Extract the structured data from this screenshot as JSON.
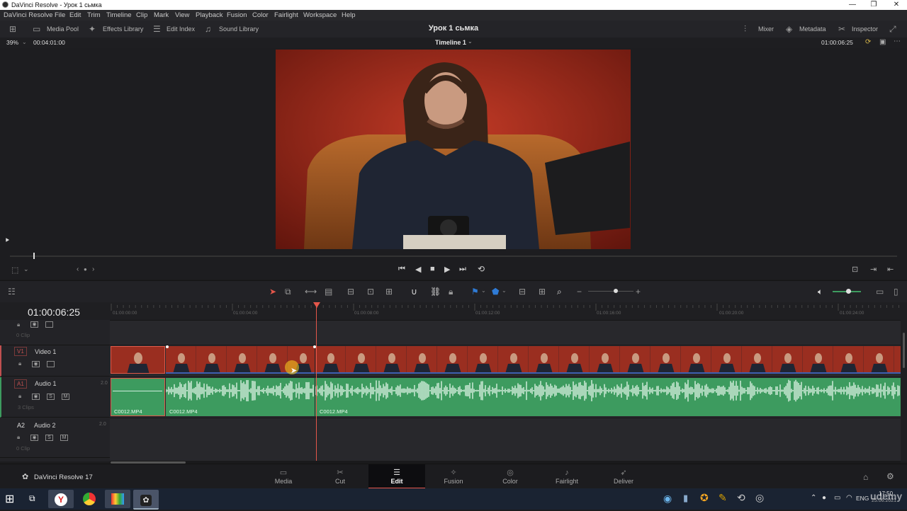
{
  "window": {
    "title": "DaVinci Resolve - Урок 1 сьмка"
  },
  "menu": [
    "DaVinci Resolve",
    "File",
    "Edit",
    "Trim",
    "Timeline",
    "Clip",
    "Mark",
    "View",
    "Playback",
    "Fusion",
    "Color",
    "Fairlight",
    "Workspace",
    "Help"
  ],
  "toolbar": {
    "media_pool": "Media Pool",
    "effects_library": "Effects Library",
    "edit_index": "Edit Index",
    "sound_library": "Sound Library",
    "project_title": "Урок 1 сьмка",
    "mixer": "Mixer",
    "metadata": "Metadata",
    "inspector": "Inspector"
  },
  "viewer": {
    "zoom": "39%",
    "duration": "00:04:01:00",
    "timeline_name": "Timeline 1",
    "timecode": "01:00:06:25"
  },
  "timeline": {
    "current_timecode": "01:00:06:25",
    "ruler_ticks": [
      "01:00:00:00",
      "01:00:04:00",
      "01:00:08:00",
      "01:00:12:00",
      "01:00:16:00",
      "01:00:20:00",
      "01:00:24:00"
    ],
    "tracks": [
      {
        "badge": "",
        "name": "",
        "clips": "0 Clip"
      },
      {
        "badge": "V1",
        "name": "Video 1",
        "clips": ""
      },
      {
        "badge": "A1",
        "name": "Audio 1",
        "level": "2.0",
        "clips": "3 Clips"
      },
      {
        "badge": "A2",
        "name": "Audio 2",
        "level": "2.0",
        "clips": "0 Clip"
      }
    ],
    "audio_clip_names": [
      "C0012.MP4",
      "C0012.MP4",
      "C0012.MP4"
    ],
    "audio_clip_color": "#3d9b5f"
  },
  "pages": {
    "app_name": "DaVinci Resolve 17",
    "tabs": [
      "Media",
      "Cut",
      "Edit",
      "Fusion",
      "Color",
      "Fairlight",
      "Deliver"
    ],
    "active": "Edit"
  },
  "taskbar": {
    "lang": "ENG",
    "time": "17:50",
    "date": "25.06.2021",
    "watermark": "udemy"
  },
  "colors": {
    "playhead": "#e4564a",
    "accent_blue": "#2f7bd6"
  }
}
